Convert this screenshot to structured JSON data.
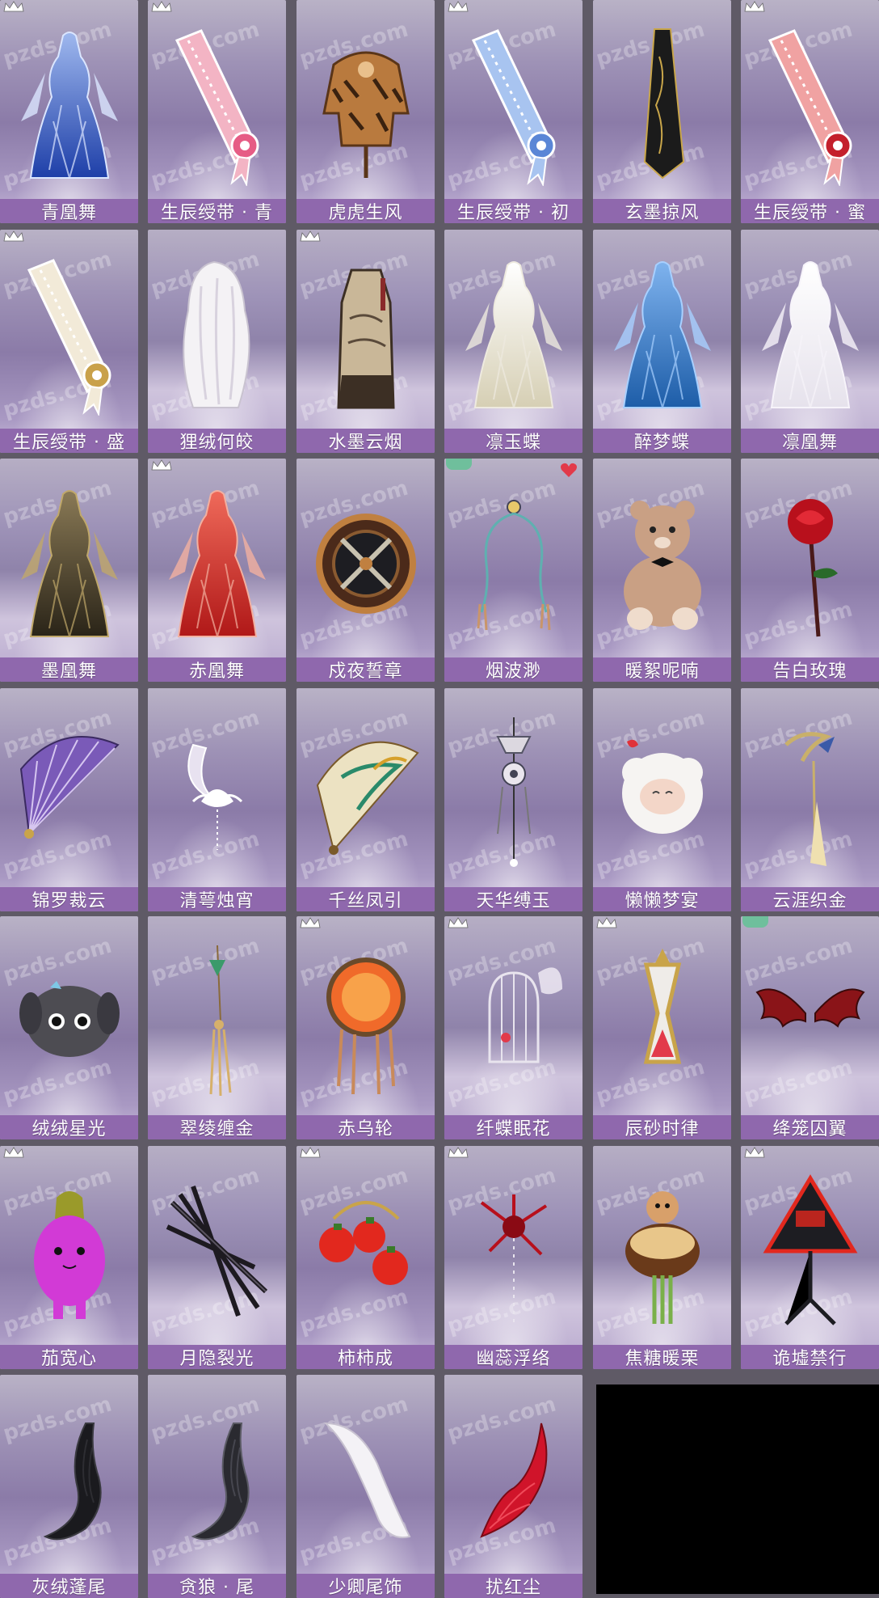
{
  "watermark": "pzds.com",
  "colors": {
    "name_bar": "#8f68ad",
    "card_bg_top": "#b9b2c6",
    "card_bg_mid": "#8b7ba8",
    "badge_green": "#6fbf9c",
    "heart": "#e23a4a"
  },
  "items": [
    {
      "name": "青凰舞",
      "icon": "blue-phoenix-dress-icon",
      "badge": "crown"
    },
    {
      "name": "生辰绶带 · 青",
      "icon": "pink-sash-icon",
      "badge": "crown"
    },
    {
      "name": "虎虎生风",
      "icon": "tiger-costume-icon",
      "badge": ""
    },
    {
      "name": "生辰绶带 · 初",
      "icon": "blue-sash-icon",
      "badge": "crown"
    },
    {
      "name": "玄墨掠风",
      "icon": "black-ink-scarf-icon",
      "badge": ""
    },
    {
      "name": "生辰绶带 · 蜜",
      "icon": "red-sash-icon",
      "badge": "crown"
    },
    {
      "name": "生辰绶带 · 盛",
      "icon": "gold-sash-icon",
      "badge": "crown"
    },
    {
      "name": "狸绒何皎",
      "icon": "white-fur-cape-icon",
      "badge": ""
    },
    {
      "name": "水墨云烟",
      "icon": "ink-wash-robe-icon",
      "badge": "crown"
    },
    {
      "name": "凛玉蝶",
      "icon": "white-butterfly-dress-icon",
      "badge": ""
    },
    {
      "name": "醉梦蝶",
      "icon": "blue-butterfly-dress-icon",
      "badge": ""
    },
    {
      "name": "凛凰舞",
      "icon": "white-phoenix-dress-icon",
      "badge": ""
    },
    {
      "name": "墨凰舞",
      "icon": "dark-phoenix-dress-icon",
      "badge": ""
    },
    {
      "name": "赤凰舞",
      "icon": "red-phoenix-dress-icon",
      "badge": "crown"
    },
    {
      "name": "戍夜誓章",
      "icon": "bronze-medallion-icon",
      "badge": ""
    },
    {
      "name": "烟波渺",
      "icon": "tassel-ornament-icon",
      "badge": "green-heart"
    },
    {
      "name": "暖絮呢喃",
      "icon": "teddy-bear-icon",
      "badge": ""
    },
    {
      "name": "告白玫瑰",
      "icon": "red-rose-icon",
      "badge": ""
    },
    {
      "name": "锦罗裁云",
      "icon": "purple-fan-icon",
      "badge": ""
    },
    {
      "name": "清萼烛宵",
      "icon": "lotus-moon-ornament-icon",
      "badge": ""
    },
    {
      "name": "千丝凤引",
      "icon": "phoenix-fan-icon",
      "badge": ""
    },
    {
      "name": "天华缚玉",
      "icon": "jade-pendant-icon",
      "badge": ""
    },
    {
      "name": "懒懒梦宴",
      "icon": "sheep-plush-icon",
      "badge": ""
    },
    {
      "name": "云涯织金",
      "icon": "gold-hairpin-icon",
      "badge": ""
    },
    {
      "name": "绒绒星光",
      "icon": "gray-puppy-plush-icon",
      "badge": ""
    },
    {
      "name": "翠绫缠金",
      "icon": "green-tassel-icon",
      "badge": ""
    },
    {
      "name": "赤乌轮",
      "icon": "sun-wheel-icon",
      "badge": "crown"
    },
    {
      "name": "纤蝶眠花",
      "icon": "birdcage-butterfly-icon",
      "badge": "crown"
    },
    {
      "name": "辰砂时律",
      "icon": "hourglass-icon",
      "badge": "crown"
    },
    {
      "name": "绛笼囚翼",
      "icon": "red-wings-icon",
      "badge": "green"
    },
    {
      "name": "茄宽心",
      "icon": "eggplant-plush-icon",
      "badge": "crown"
    },
    {
      "name": "月隐裂光",
      "icon": "dark-blades-icon",
      "badge": ""
    },
    {
      "name": "柿柿成",
      "icon": "persimmon-charm-icon",
      "badge": "crown"
    },
    {
      "name": "幽蕊浮络",
      "icon": "red-spider-lily-icon",
      "badge": "crown"
    },
    {
      "name": "焦糖暖栗",
      "icon": "hamster-cake-icon",
      "badge": ""
    },
    {
      "name": "诡墟禁行",
      "icon": "warning-sign-icon",
      "badge": "crown"
    },
    {
      "name": "灰绒蓬尾",
      "icon": "black-fluffy-tail-icon",
      "badge": ""
    },
    {
      "name": "贪狼 · 尾",
      "icon": "wolf-tail-icon",
      "badge": ""
    },
    {
      "name": "少卿尾饰",
      "icon": "white-tail-icon",
      "badge": ""
    },
    {
      "name": "扰红尘",
      "icon": "red-fox-tail-icon",
      "badge": ""
    }
  ]
}
